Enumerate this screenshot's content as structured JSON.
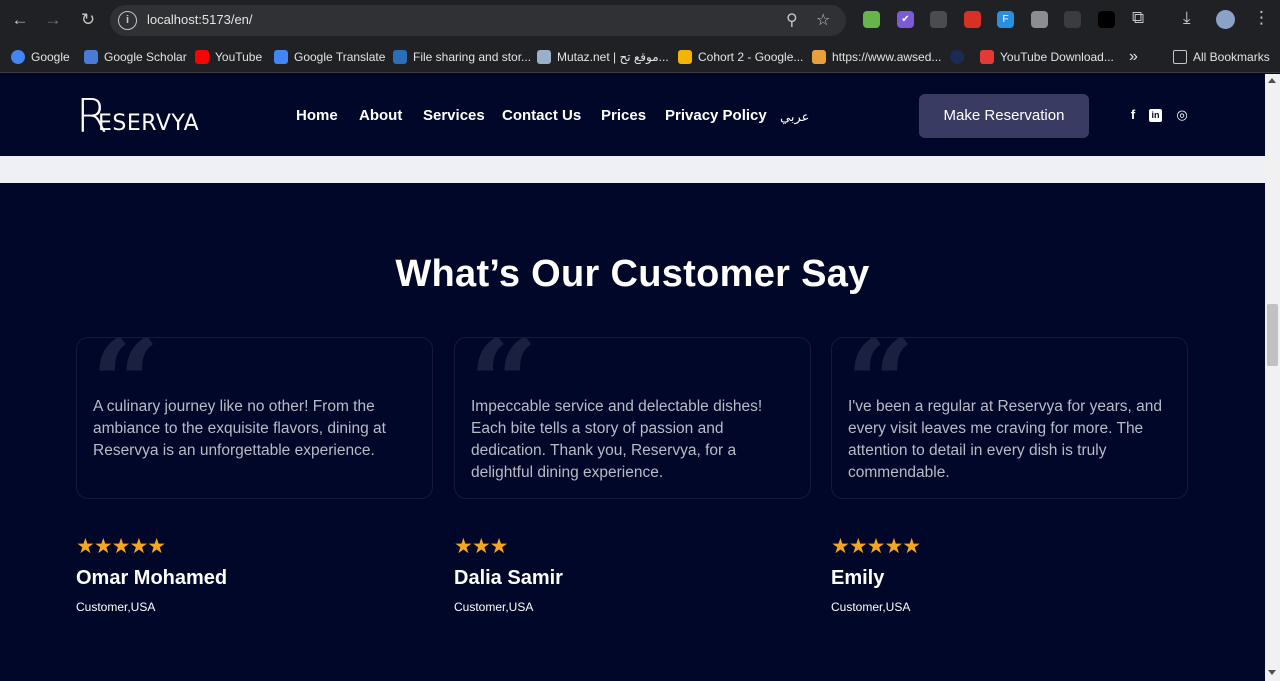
{
  "browser": {
    "url": "localhost:5173/en/",
    "bookmarks": [
      {
        "label": "Google",
        "color": "#4285f4"
      },
      {
        "label": "Google Scholar",
        "color": "#4a7ad8"
      },
      {
        "label": "YouTube",
        "color": "#ff0000"
      },
      {
        "label": "Google Translate",
        "color": "#4285f4"
      },
      {
        "label": "File sharing and stor...",
        "color": "#2a6ebb"
      },
      {
        "label": "Mutaz.net | موقع تح...",
        "color": "#9bb0c8"
      },
      {
        "label": "Cohort 2 - Google...",
        "color": "#f4b400"
      },
      {
        "label": "https://www.awsed...",
        "color": "#e8a13a"
      },
      {
        "label": "",
        "color": "#1c2a56"
      },
      {
        "label": "YouTube Download...",
        "color": "#e53935"
      }
    ],
    "more_label": "»",
    "all_bookmarks": "All Bookmarks"
  },
  "header": {
    "logo_big": "R",
    "logo_rest": "ESERVYA",
    "nav": [
      "Home",
      "About",
      "Services",
      "Contact Us",
      "Prices",
      "Privacy Policy",
      "عربي"
    ],
    "cta": "Make Reservation",
    "social": [
      "f",
      "in",
      "◎"
    ]
  },
  "testimonials": {
    "title": "What’s Our Customer Say",
    "quote_glyph": "“",
    "items": [
      {
        "text": "A culinary journey like no other! From the ambiance to the exquisite flavors, dining at Reservya is an unforgettable experience.",
        "stars": "★★★★★",
        "rating": 5,
        "name": "Omar Mohamed",
        "location": "Customer,USA"
      },
      {
        "text": "Impeccable service and delectable dishes! Each bite tells a story of passion and dedication. Thank you, Reservya, for a delightful dining experience.",
        "stars": "★★★",
        "rating": 3,
        "name": "Dalia Samir",
        "location": "Customer,USA"
      },
      {
        "text": "I've been a regular at Reservya for years, and every visit leaves me craving for more. The attention to detail in every dish is truly commendable.",
        "stars": "★★★★★",
        "rating": 5,
        "name": "Emily",
        "location": "Customer,USA"
      }
    ]
  },
  "colors": {
    "background": "#000729",
    "cta": "#3a3b62",
    "star": "#f5a623"
  }
}
